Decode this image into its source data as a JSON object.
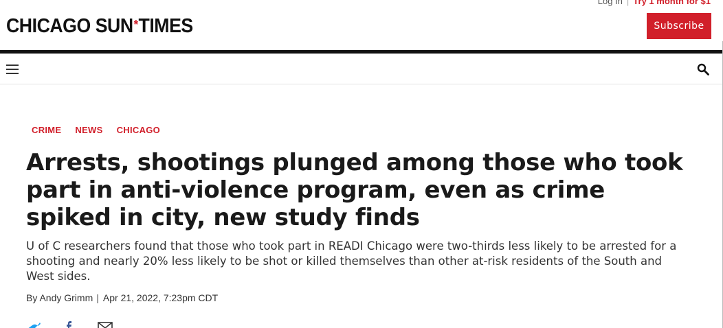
{
  "header": {
    "login_label": "Log In",
    "trial_label": "Try 1 month for $1",
    "logo_left": "CHICAGO SUN",
    "logo_star": "*",
    "logo_right": "TIMES",
    "subscribe_label": "Subscribe"
  },
  "nav": {
    "menu_icon": "hamburger-menu-icon",
    "search_icon": "search-icon"
  },
  "article": {
    "categories": [
      "CRIME",
      "NEWS",
      "CHICAGO"
    ],
    "headline": "Arrests, shootings plunged among those who took part in anti-violence program, even as crime spiked in city, new study finds",
    "dek": "U of C researchers found that those who took part in READI Chicago were two-thirds less likely to be arrested for a shooting and nearly 20% less likely to be shot or killed themselves than other at-risk residents of the South and West sides.",
    "byline_author": "By Andy Grimm",
    "byline_sep": "|",
    "byline_date": "Apr 21, 2022, 7:23pm CDT"
  },
  "share": {
    "icons": [
      "twitter-icon",
      "facebook-icon",
      "email-icon"
    ]
  },
  "colors": {
    "brand_red": "#d11f2a",
    "text_dark": "#1a1a1a"
  }
}
